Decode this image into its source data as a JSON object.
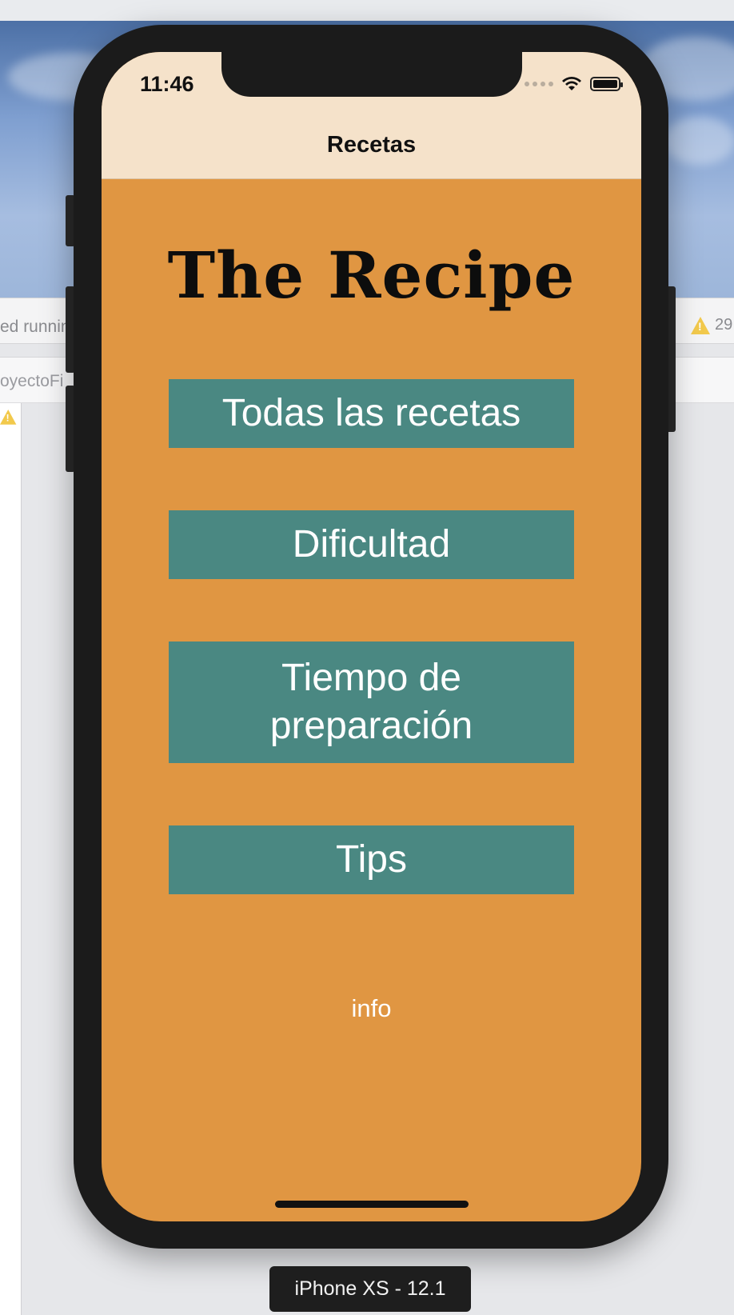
{
  "xcode": {
    "status_text": "ed runnin",
    "project_text": "oyectoFi",
    "warning_count": "29"
  },
  "device": {
    "label": "iPhone XS - 12.1"
  },
  "status_bar": {
    "time": "11:46"
  },
  "navigation": {
    "title": "Recetas"
  },
  "main": {
    "app_title": "The Recipe",
    "buttons": [
      {
        "label": "Todas las recetas"
      },
      {
        "label": "Dificultad"
      },
      {
        "label": "Tiempo de preparación"
      },
      {
        "label": "Tips"
      }
    ],
    "info_label": "info"
  },
  "colors": {
    "navbar_bg": "#f5e2ca",
    "screen_bg": "#e09642",
    "button_bg": "#4a8882",
    "button_text": "#ffffff"
  }
}
